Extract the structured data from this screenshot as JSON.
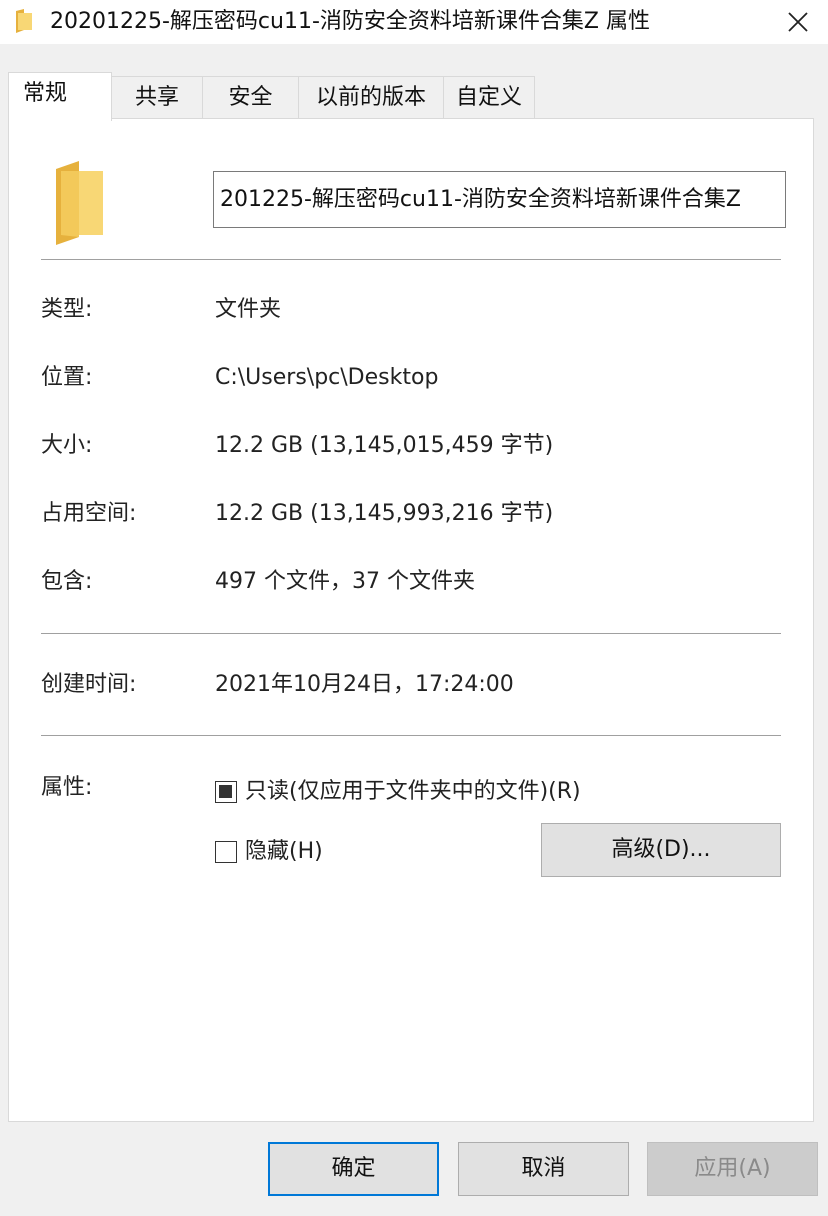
{
  "window": {
    "title": "20201225-解压密码cu11-消防安全资料培新课件合集Z 属性"
  },
  "tabs": [
    {
      "label": "常规",
      "active": true
    },
    {
      "label": "共享",
      "active": false
    },
    {
      "label": "安全",
      "active": false
    },
    {
      "label": "以前的版本",
      "active": false
    },
    {
      "label": "自定义",
      "active": false
    }
  ],
  "general": {
    "folder_name": "201225-解压密码cu11-消防安全资料培新课件合集Z",
    "rows": {
      "type": {
        "label": "类型:",
        "value": "文件夹"
      },
      "location": {
        "label": "位置:",
        "value": "C:\\Users\\pc\\Desktop"
      },
      "size": {
        "label": "大小:",
        "value": "12.2 GB (13,145,015,459 字节)"
      },
      "size_on_disk": {
        "label": "占用空间:",
        "value": "12.2 GB (13,145,993,216 字节)"
      },
      "contains": {
        "label": "包含:",
        "value": "497 个文件，37 个文件夹"
      },
      "created": {
        "label": "创建时间:",
        "value": "2021年10月24日，17:24:00"
      }
    },
    "attributes": {
      "label": "属性:",
      "readonly": {
        "label": "只读(仅应用于文件夹中的文件)(R)",
        "state": "indeterminate"
      },
      "hidden": {
        "label": "隐藏(H)",
        "checked": false
      },
      "advanced_button": "高级(D)..."
    }
  },
  "footer": {
    "ok": "确定",
    "cancel": "取消",
    "apply": "应用(A)"
  },
  "icons": {
    "title": "folder-icon",
    "close": "close-icon",
    "main": "folder-icon"
  },
  "colors": {
    "folder": "#f8d775",
    "accent": "#0078d7"
  }
}
